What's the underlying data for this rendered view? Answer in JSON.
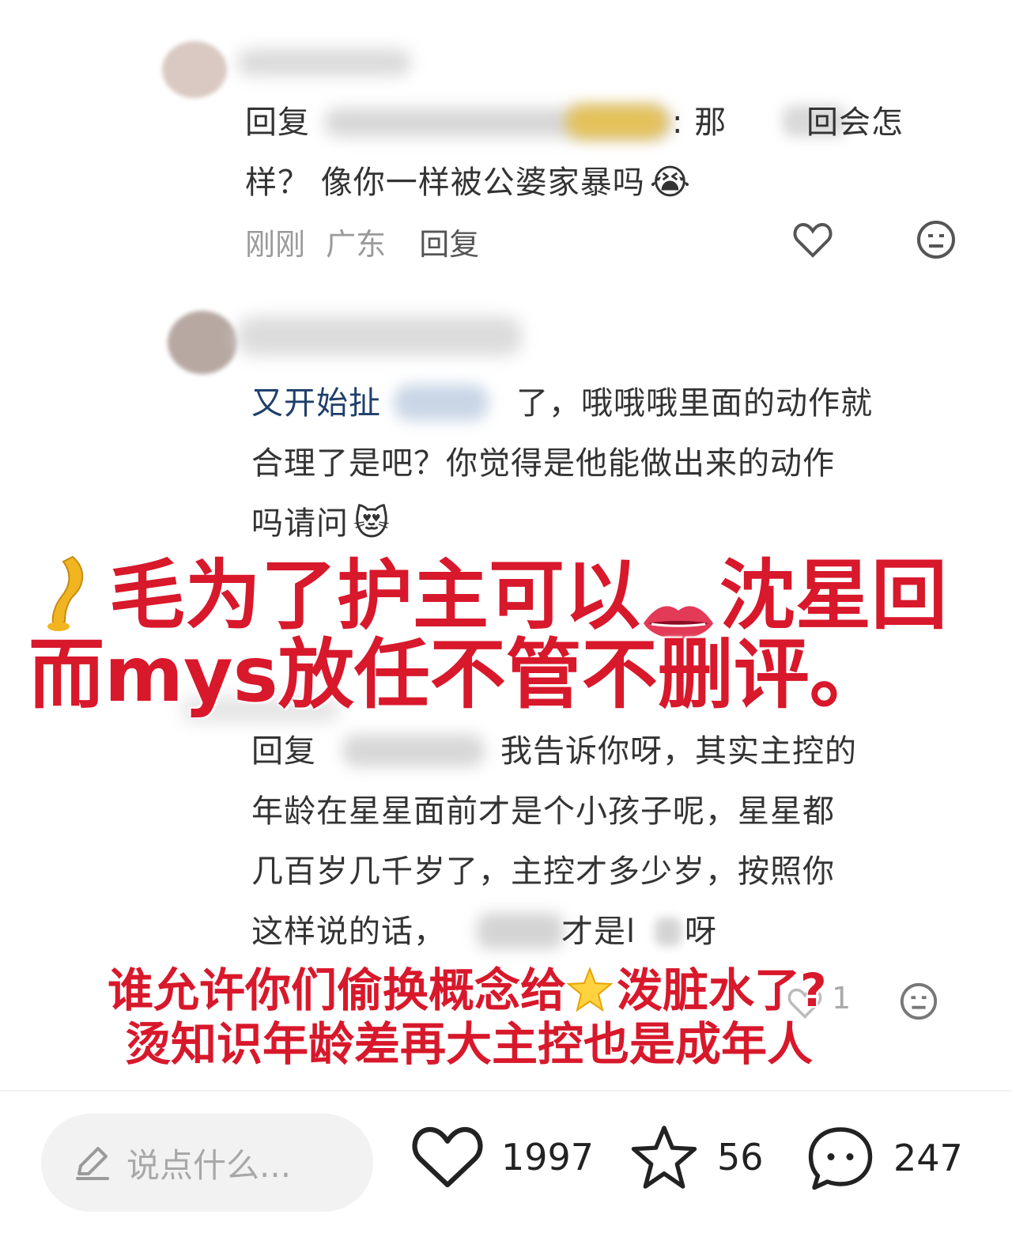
{
  "comment1": {
    "reply_prefix": "回复",
    "line1_tail": ":  那",
    "line1_tail2": "回会怎",
    "line2": "样？ 像你一样被公婆家暴吗",
    "time": "刚刚",
    "region": "广东",
    "reply_label": "回复"
  },
  "comment2": {
    "line1_start": "又开始扯",
    "line1_tail": "了，哦哦哦里面的动作就",
    "line2": "合理了是吧？你觉得是他能做出来的动作",
    "line3": "吗请问"
  },
  "comment3": {
    "reply_prefix": "回复",
    "line1_tail": "我告诉你呀，其实主控的",
    "line2": "年龄在星星面前才是个小孩子呢，星星都",
    "line3": "几百岁几千岁了，主控才多少岁，按照你",
    "line4_start": "这样说的话，",
    "line4_tail": "才是l",
    "line4_end": "呀",
    "likes": "1"
  },
  "overlay1": {
    "line1": "毛为了护主可以",
    "line1_tail": "沈星回",
    "line2": "而mys放任不管不删评。"
  },
  "overlay2": {
    "line1": "谁允许你们偷换概念给",
    "line1_tail": "泼脏水了?",
    "line2": "烫知识年龄差再大主控也是成年人"
  },
  "bottom": {
    "input_placeholder": "说点什么...",
    "likes": "1997",
    "stars": "56",
    "comments": "247"
  },
  "icons": [
    "heart-icon",
    "dislike-face-icon",
    "pencil-icon",
    "star-icon",
    "chat-bubble-icon",
    "leg-emoji-icon",
    "lips-emoji-icon",
    "star-emoji-icon"
  ],
  "colors": {
    "overlay_red": "#d8182b",
    "mention_blue": "#1f3f6b",
    "meta_gray": "#9a9a9a"
  }
}
